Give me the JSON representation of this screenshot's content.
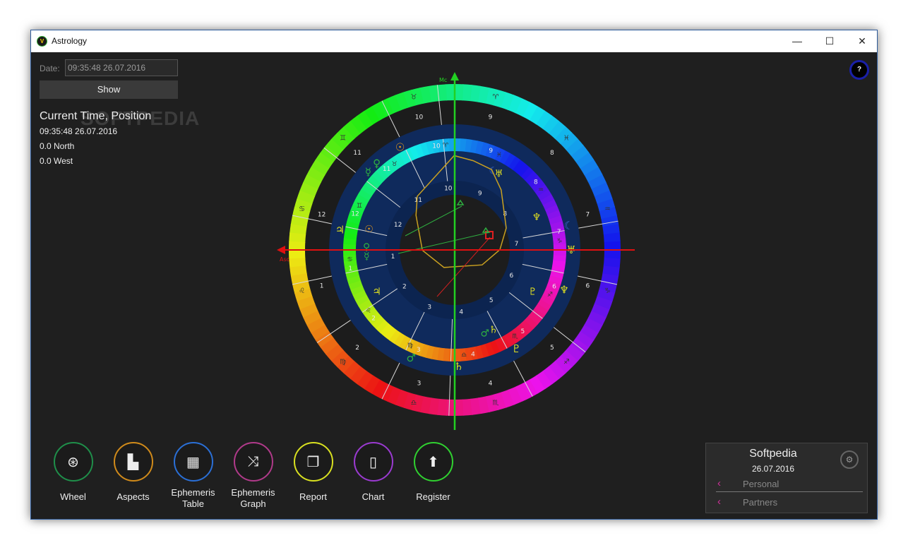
{
  "window": {
    "title": "Astrology",
    "app_icon": "astrology-app-icon",
    "controls": {
      "minimize": "—",
      "maximize": "☐",
      "close": "✕"
    }
  },
  "date": {
    "label": "Date:",
    "value": "09:35:48 26.07.2016"
  },
  "show_button": "Show",
  "watermark": "SOFTPEDIA",
  "current": {
    "title": "Current Time, Position",
    "time": "09:35:48 26.07.2016",
    "lat": "0.0 North",
    "lon": "0.0 West"
  },
  "help": "?",
  "chart": {
    "mc_label": "Mc",
    "asc_label": "Asc",
    "signs": [
      "♈",
      "♉",
      "♊",
      "♋",
      "♌",
      "♍",
      "♎",
      "♏",
      "♐",
      "♑",
      "♒",
      "♓"
    ],
    "outer_houses": [
      "1",
      "2",
      "3",
      "4",
      "5",
      "6",
      "7",
      "8",
      "9",
      "10",
      "11",
      "12"
    ],
    "middle_houses": [
      "1",
      "2",
      "3",
      "4",
      "5",
      "6",
      "7",
      "8",
      "9",
      "10",
      "11",
      "12"
    ],
    "inner_houses": [
      "1",
      "2",
      "3",
      "4",
      "5",
      "6",
      "7",
      "8",
      "9",
      "10",
      "11",
      "12"
    ],
    "outer_planets": [
      "☉",
      "♀",
      "☿",
      "♃",
      "♂",
      "♄",
      "♇",
      "♆",
      "♅",
      "☾"
    ],
    "middle_planets": [
      "☉",
      "♀",
      "☿",
      "♃",
      "♂",
      "♄",
      "♇",
      "♆",
      "♅",
      "☾"
    ]
  },
  "nav": [
    {
      "label": "Wheel",
      "icon": "wheel-icon",
      "glyph": "⊛",
      "color": "#1f8f4a"
    },
    {
      "label": "Aspects",
      "icon": "aspects-icon",
      "glyph": "▙",
      "color": "#d08a1a"
    },
    {
      "label": "Ephemeris",
      "label2": "Table",
      "icon": "table-icon",
      "glyph": "▦",
      "color": "#2a6fd6"
    },
    {
      "label": "Ephemeris",
      "label2": "Graph",
      "icon": "shuffle-graph-icon",
      "glyph": "⤨",
      "color": "#b03a8a"
    },
    {
      "label": "Report",
      "icon": "report-icon",
      "glyph": "❐",
      "color": "#d8e020"
    },
    {
      "label": "Chart",
      "icon": "document-icon",
      "glyph": "▯",
      "color": "#9a3ad0"
    },
    {
      "label": "Register",
      "icon": "arrow-up-icon",
      "glyph": "⬆",
      "color": "#30d030"
    }
  ],
  "profile": {
    "name": "Softpedia",
    "date": "26.07.2016",
    "items": [
      "Personal",
      "Partners"
    ]
  }
}
